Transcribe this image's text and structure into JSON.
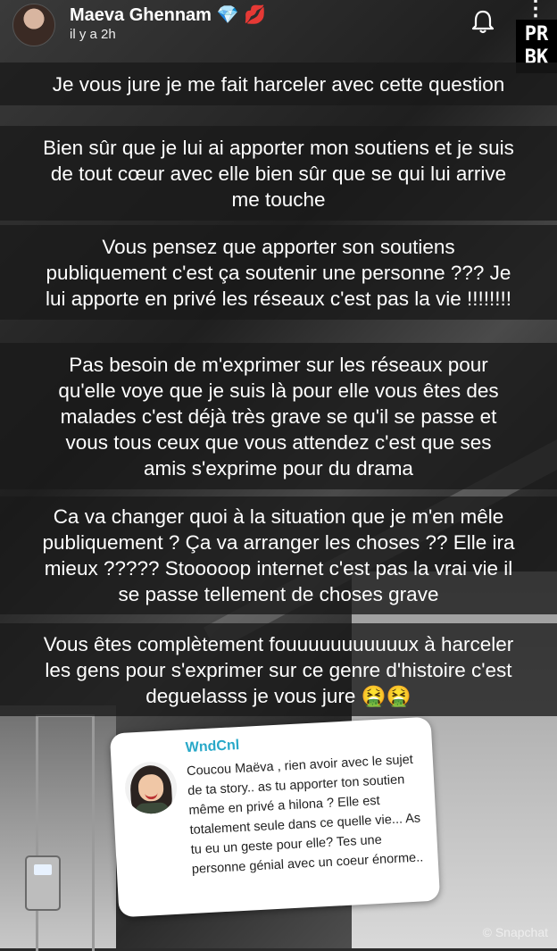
{
  "header": {
    "username": "Maeva Ghennam 💎 💋",
    "timestamp": "il y a 2h",
    "bell_icon": "bell-icon",
    "more_icon": "more-vertical-icon",
    "more_glyph": "⋮",
    "logo_text": "PR\nBK"
  },
  "captions": [
    "Je vous jure je me fait harceler avec cette question",
    "Bien sûr que je lui ai apporter mon soutiens et je suis\nde tout cœur avec elle bien sûr que se qui lui arrive\nme touche",
    "Vous pensez que apporter son soutiens\npubliquement c'est ça soutenir une personne ??? Je\nlui apporte en privé les réseaux c'est pas la vie !!!!!!!!",
    "Pas besoin de m'exprimer sur les réseaux pour\nqu'elle voye que je suis là pour elle vous êtes des\nmalades c'est déjà très grave se qu'il se passe et\nvous tous ceux que vous attendez c'est que ses\namis s'exprime pour du drama",
    "Ca va changer quoi à la situation que je m'en mêle\npubliquement ? Ça va arranger les choses ?? Elle ira\nmieux ????? Stooooop internet c'est pas la vrai vie il\nse passe tellement de choses grave",
    "Vous êtes complètement fouuuuuuuuuuux à harceler\nles gens pour s'exprimer sur ce genre d'histoire c'est\ndeguelasss je vous jure 🤮🤮"
  ],
  "question": {
    "name": "WndCnl",
    "text": "Coucou Maëva , rien avoir avec le sujet de ta story.. as tu apporter ton soutien même en privé a hilona ? Elle est totalement seule dans ce quelle vie... As tu eu un geste pour elle? Tes une personne génial avec un coeur énorme.."
  },
  "watermark": "© Snapchat"
}
